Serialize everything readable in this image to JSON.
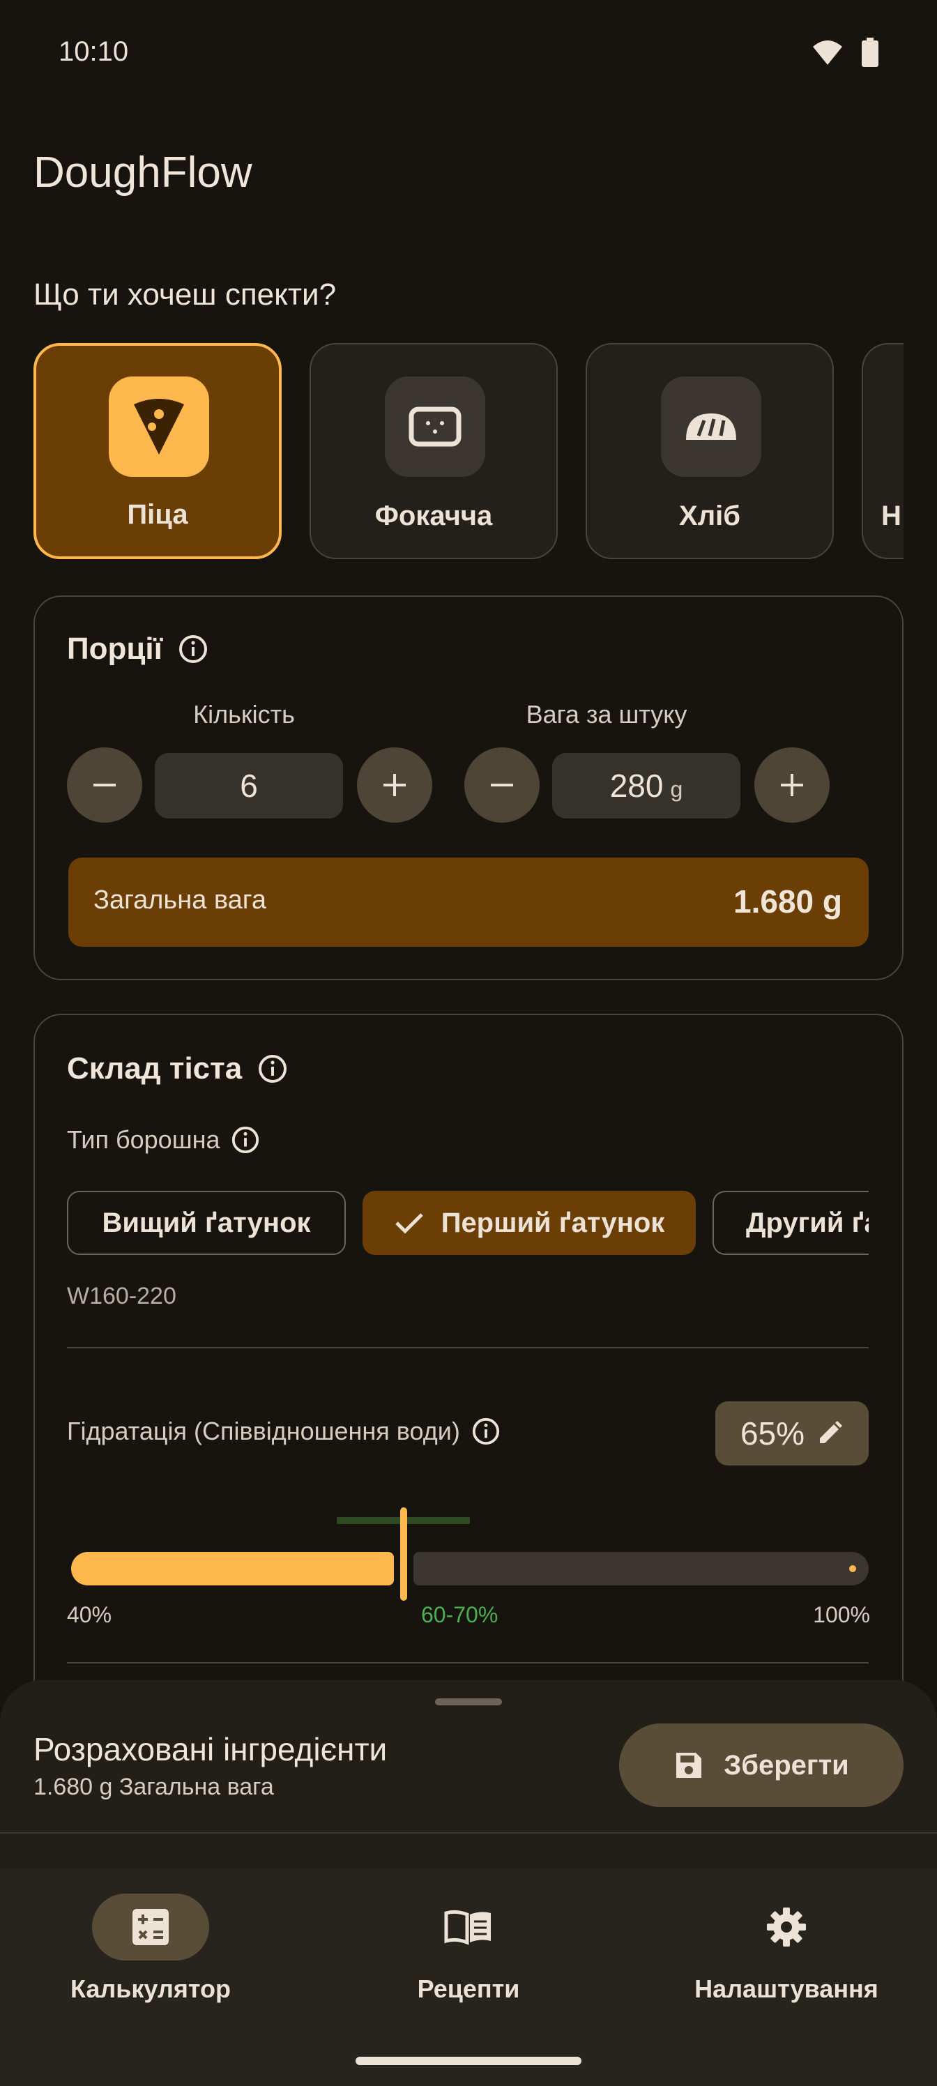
{
  "status": {
    "time": "10:10"
  },
  "app": {
    "title": "DoughFlow"
  },
  "bake_question": "Що ти хочеш спекти?",
  "categories": [
    {
      "label": "Піца",
      "icon": "pizza-icon",
      "selected": true
    },
    {
      "label": "Фокачча",
      "icon": "focaccia-icon",
      "selected": false
    },
    {
      "label": "Хліб",
      "icon": "bread-icon",
      "selected": false
    },
    {
      "label": "Н",
      "icon": "partial-icon",
      "selected": false
    }
  ],
  "portions": {
    "title": "Порції",
    "count_label": "Кількість",
    "count_value": "6",
    "weight_label": "Вага за штуку",
    "weight_value": "280",
    "weight_unit": "g",
    "total_label": "Загальна вага",
    "total_value": "1.680 g"
  },
  "dough": {
    "title": "Склад тіста",
    "flour_label": "Тип борошна",
    "flour_options": [
      "Вищий ґатунок",
      "Перший ґатунок",
      "Другий ґа"
    ],
    "flour_selected_index": 1,
    "flour_strength": "W160-220",
    "hydration_label": "Гідратація (Співвідношення води)",
    "hydration_value": "65%",
    "hydration_fraction": 0.65,
    "range_min": "40%",
    "range_recommended": "60-70%",
    "range_max": "100%"
  },
  "sheet": {
    "title": "Розраховані інгредієнти",
    "subtitle": "1.680 g Загальна вага",
    "save_label": "Зберегти"
  },
  "nav": [
    {
      "label": "Калькулятор",
      "icon": "calculator-icon",
      "active": true
    },
    {
      "label": "Рецепти",
      "icon": "book-icon",
      "active": false
    },
    {
      "label": "Налаштування",
      "icon": "gear-icon",
      "active": false
    }
  ],
  "colors": {
    "accent": "#ffb84d",
    "accent_dark": "#6b3e05",
    "background": "#17140f",
    "recommended": "#4caf50"
  }
}
